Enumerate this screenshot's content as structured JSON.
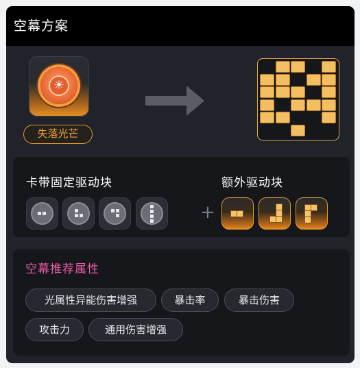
{
  "header": {
    "title": "空幕方案"
  },
  "item": {
    "name": "失落光芒",
    "icon": "compass-disc-icon",
    "accent": "#e39a2f"
  },
  "drive": {
    "title": "卡带固定驱动块",
    "extra_title": "额外驱动块",
    "plus": "+",
    "fixed_slots": [
      "domino-icon",
      "tromino-l-icon",
      "tromino-l-icon",
      "tetromino-i-icon"
    ],
    "extra_slots": [
      "domino-icon",
      "tetromino-l-icon",
      "tetromino-l-icon"
    ]
  },
  "attributes": {
    "title": "空幕推荐属性",
    "title_color": "#e85aa8",
    "tags": [
      "光属性异能伤害增强",
      "暴击率",
      "暴击伤害",
      "攻击力",
      "通用伤害增强"
    ]
  }
}
